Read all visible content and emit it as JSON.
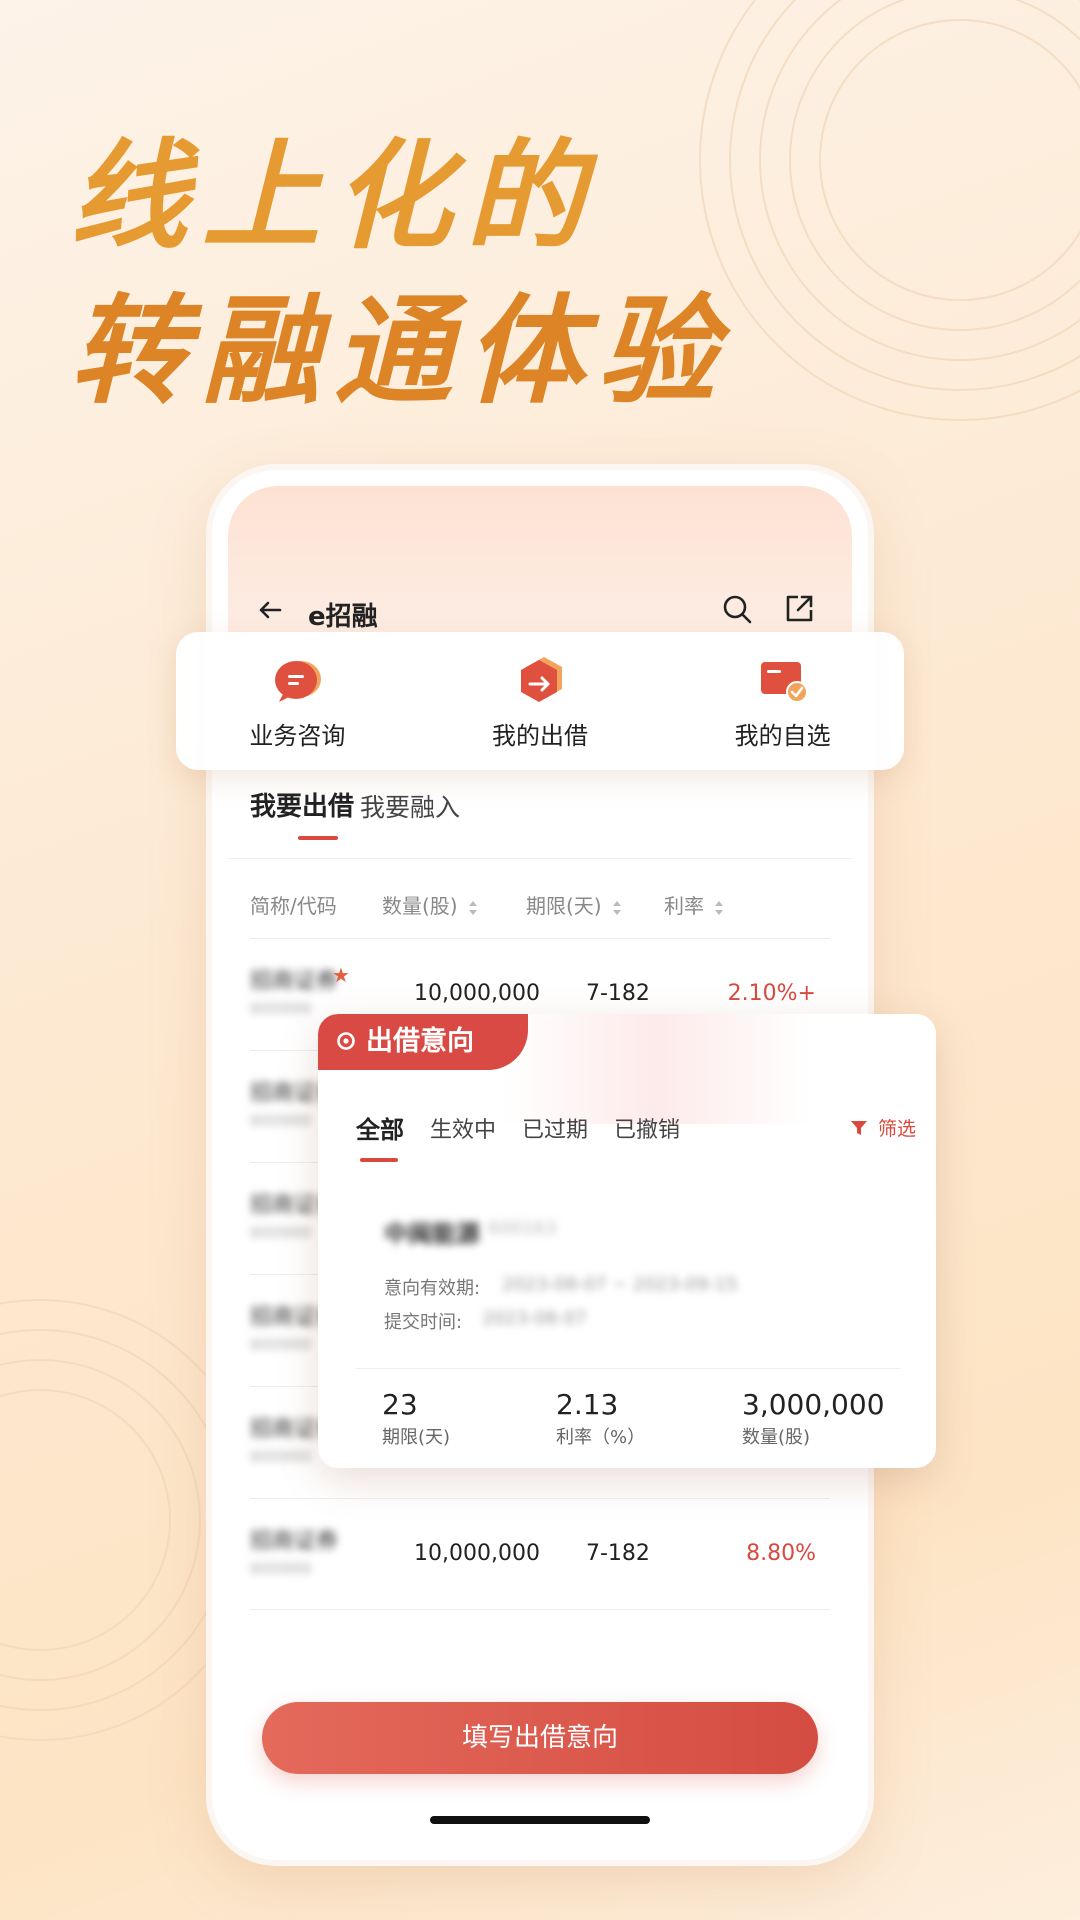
{
  "headline": {
    "line1": "线上化的",
    "line2": "转融通体验"
  },
  "nav": {
    "title": "e招融",
    "back_icon": "arrow-left-icon",
    "search_icon": "search-icon",
    "share_icon": "share-icon"
  },
  "quick_actions": [
    {
      "label": "业务咨询",
      "icon": "chat-bubble-icon"
    },
    {
      "label": "我的出借",
      "icon": "lend-hexagon-icon"
    },
    {
      "label": "我的自选",
      "icon": "watchlist-card-icon"
    }
  ],
  "tabs": {
    "lend": "我要出借",
    "borrow": "我要融入"
  },
  "table": {
    "headers": {
      "name": "简称/代码",
      "qty": "数量(股)",
      "term": "期限(天)",
      "rate": "利率"
    },
    "rows": [
      {
        "name": "招商证券",
        "code": "600999",
        "qty": "10,000,000",
        "term": "7-182",
        "rate": "2.10%+"
      },
      {
        "name": "招商证券",
        "code": "600999",
        "qty": "",
        "term": "",
        "rate": ""
      },
      {
        "name": "招商证券",
        "code": "600999",
        "qty": "",
        "term": "",
        "rate": ""
      },
      {
        "name": "招商证券",
        "code": "600999",
        "qty": "",
        "term": "",
        "rate": ""
      },
      {
        "name": "招商证券",
        "code": "600999",
        "qty": "",
        "term": "",
        "rate": ""
      },
      {
        "name": "招商证券",
        "code": "600999",
        "qty": "10,000,000",
        "term": "7-182",
        "rate": "8.80%"
      }
    ]
  },
  "intent_card": {
    "tag": "出借意向",
    "tabs": [
      "全部",
      "生效中",
      "已过期",
      "已撤销"
    ],
    "filter": "筛选",
    "item": {
      "name": "中闽能源",
      "code": "600163",
      "valid_label": "意向有效期:",
      "valid_value": "2023-08-07 ~ 2023-09-15",
      "submit_label": "提交时间:",
      "submit_value": "2023-08-07",
      "term_value": "23",
      "term_label": "期限(天)",
      "rate_value": "2.13",
      "rate_label": "利率（%）",
      "qty_value": "3,000,000",
      "qty_label": "数量(股)"
    }
  },
  "submit_button": "填写出借意向",
  "colors": {
    "accent": "#d84a3e",
    "headline": "#e69a32"
  }
}
